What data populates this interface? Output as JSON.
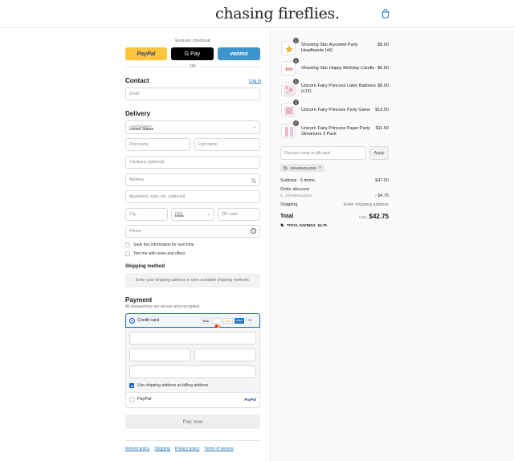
{
  "header": {
    "logo": "chasing fireflies."
  },
  "express": {
    "label": "Express checkout",
    "paypal": "PayPal",
    "gpay": "G Pay",
    "venmo": "venmo",
    "or": "OR"
  },
  "contact": {
    "title": "Contact",
    "login": "Log in",
    "email_placeholder": "Email"
  },
  "delivery": {
    "title": "Delivery",
    "country_label": "Country/Region",
    "country_value": "United States",
    "first_name": "First name",
    "last_name": "Last name",
    "company": "Company (optional)",
    "address": "Address",
    "apartment": "Apartment, suite, etc. (optional)",
    "city": "City",
    "state_label": "State",
    "state_value": "Iowa",
    "zip": "ZIP code",
    "phone": "Phone",
    "save_info": "Save this information for next time",
    "text_me": "Text me with news and offers"
  },
  "shipping": {
    "title": "Shipping method",
    "placeholder": "Enter your shipping address to view available shipping methods."
  },
  "payment": {
    "title": "Payment",
    "subtitle": "All transactions are secure and encrypted.",
    "credit_card": "Credit card",
    "card_logos": [
      "VISA",
      "MC",
      "DISC",
      "AMEX",
      "+5"
    ],
    "use_shipping": "Use shipping address as billing address",
    "paypal": "PayPal",
    "paypal_logo": "PayPal"
  },
  "pay_now": "Pay now",
  "footer": {
    "refund": "Refund policy",
    "shipping": "Shipping",
    "privacy": "Privacy policy",
    "terms": "Terms of service"
  },
  "cart": {
    "items": [
      {
        "qty": "1",
        "name": "Shooting Star Assorted Party Headbands (x6)",
        "price": "$8.00"
      },
      {
        "qty": "1",
        "name": "Shooting Star Happy Birthday Candle",
        "price": "$6.50"
      },
      {
        "qty": "1",
        "name": "Unicorn Fairy Princess Latex Balloons (x12)",
        "price": "$8.00"
      },
      {
        "qty": "1",
        "name": "Unicorn Fairy Princess Party Game",
        "price": "$13.50"
      },
      {
        "qty": "1",
        "name": "Unicorn Fairy Princess Paper Party Streamers 3 Pack",
        "price": "$11.50"
      }
    ],
    "discount_placeholder": "Discount code or gift card",
    "apply": "Apply",
    "code_tag": "10%SINGLEDIS",
    "subtotal_label": "Subtotal · 5 items",
    "subtotal_value": "$47.50",
    "order_discount_label": "Order discount",
    "order_discount_code": "10%SINGLEDIS",
    "order_discount_value": "- $4.75",
    "shipping_label": "Shipping",
    "shipping_value": "Enter shipping address",
    "total_label": "Total",
    "currency": "USD",
    "total_value": "$42.75",
    "savings_label": "TOTAL SAVINGS",
    "savings_value": "$4.75"
  }
}
